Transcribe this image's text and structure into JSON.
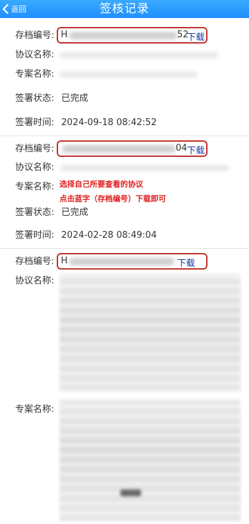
{
  "header": {
    "back_label": "返回",
    "title": "签核记录"
  },
  "labels": {
    "archive_no": "存档编号:",
    "agreement_name": "协议名称:",
    "project_name": "专案名称:",
    "sign_status": "签署状态:",
    "sign_time": "签署时间:"
  },
  "records": [
    {
      "archive_prefix": "H",
      "archive_suffix": "52",
      "download_label": "下载",
      "status": "已完成",
      "time": "2024-09-18 08:42:52"
    },
    {
      "archive_prefix": "",
      "archive_suffix": "04",
      "download_label": "下载",
      "status": "已完成",
      "time": "2024-02-28 08:49:04"
    },
    {
      "archive_prefix": "H",
      "archive_suffix": "",
      "download_label": "下载"
    }
  ],
  "annotation": {
    "line1": "选择自己所要查看的协议",
    "line2": "点击蓝字（存档编号）下载即可"
  },
  "colors": {
    "header_bg": "#1e90ff",
    "highlight_box": "#c0332b",
    "download_link": "#1a3a9c",
    "annotation_text": "#e02020"
  }
}
